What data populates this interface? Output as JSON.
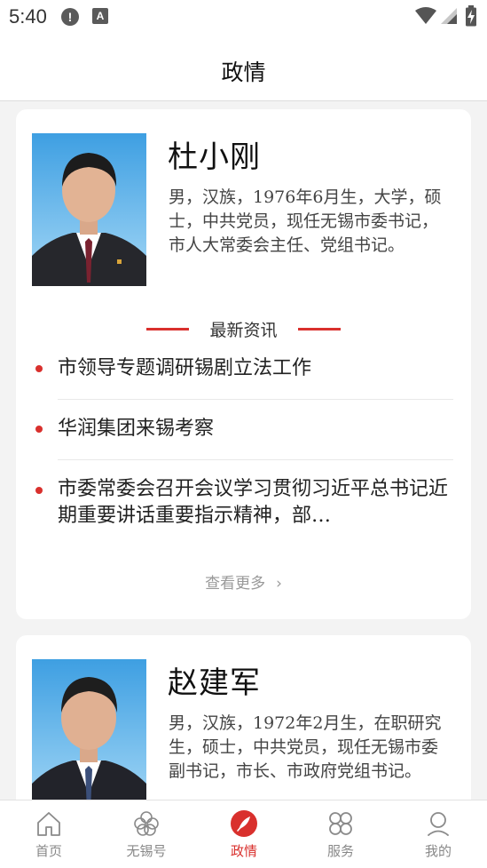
{
  "status_bar": {
    "time": "5:40",
    "icons": [
      "alert-icon",
      "a-icon",
      "wifi-icon",
      "signal-icon",
      "battery-charging-icon"
    ]
  },
  "header": {
    "title": "政情"
  },
  "leaders": [
    {
      "name": "杜小刚",
      "bio": "男，汉族，1976年6月生，大学，硕士，中共党员，现任无锡市委书记，市人大常委会主任、党组书记。",
      "news_heading": "最新资讯",
      "news": [
        "市领导专题调研锡剧立法工作",
        "华润集团来锡考察",
        "市委常委会召开会议学习贯彻习近平总书记近期重要讲话重要指示精神，部…"
      ],
      "more_label": "查看更多"
    },
    {
      "name": "赵建军",
      "bio": "男，汉族，1972年2月生，在职研究生，硕士，中共党员，现任无锡市委副书记，市长、市政府党组书记。"
    }
  ],
  "tabs": [
    {
      "label": "首页",
      "icon": "home-icon",
      "active": false
    },
    {
      "label": "无锡号",
      "icon": "wuxi-flower-icon",
      "active": false
    },
    {
      "label": "政情",
      "icon": "quill-icon",
      "active": true
    },
    {
      "label": "服务",
      "icon": "grid-icon",
      "active": false
    },
    {
      "label": "我的",
      "icon": "user-icon",
      "active": false
    }
  ],
  "colors": {
    "accent": "#d9302d",
    "background": "#f3f3f3",
    "card": "#ffffff",
    "muted_text": "#999999"
  }
}
